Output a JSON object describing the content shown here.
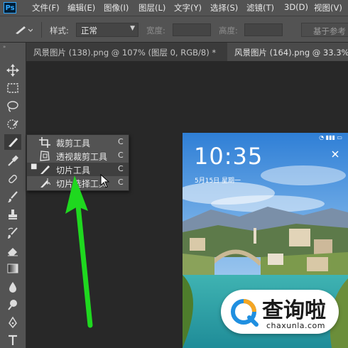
{
  "app": {
    "logo_text": "Ps"
  },
  "menu": [
    "文件(F)",
    "编辑(E)",
    "图像(I)",
    "图层(L)",
    "文字(Y)",
    "选择(S)",
    "滤镜(T)",
    "3D(D)",
    "视图(V)"
  ],
  "options": {
    "style_label": "样式:",
    "style_value": "正常",
    "width_label": "宽度:",
    "height_label": "高度:",
    "ref_button": "基于参考"
  },
  "tabs": [
    {
      "label": "风景图片 (138).png @ 107% (图层 0, RGB/8) *",
      "close": "×"
    },
    {
      "label": "风景图片 (164).png @ 33.3%(图"
    }
  ],
  "flyout": {
    "items": [
      {
        "label": "裁剪工具",
        "key": "C",
        "icon": "crop-icon",
        "selected": false
      },
      {
        "label": "透视裁剪工具",
        "key": "C",
        "icon": "perspective-crop-icon",
        "selected": false
      },
      {
        "label": "切片工具",
        "key": "C",
        "icon": "slice-icon",
        "selected": true
      },
      {
        "label": "切片选择工具",
        "key": "C",
        "icon": "slice-select-icon",
        "selected": false
      }
    ],
    "bullet": "■"
  },
  "photo": {
    "time": "10:35",
    "date": "5月15日 星期一"
  },
  "watermark": {
    "cn": "查询啦",
    "en": "chaxunla.com"
  },
  "colors": {
    "arrow": "#1fd81f",
    "panel": "#535353",
    "workspace": "#282828",
    "ps_blue": "#31a8ff"
  }
}
